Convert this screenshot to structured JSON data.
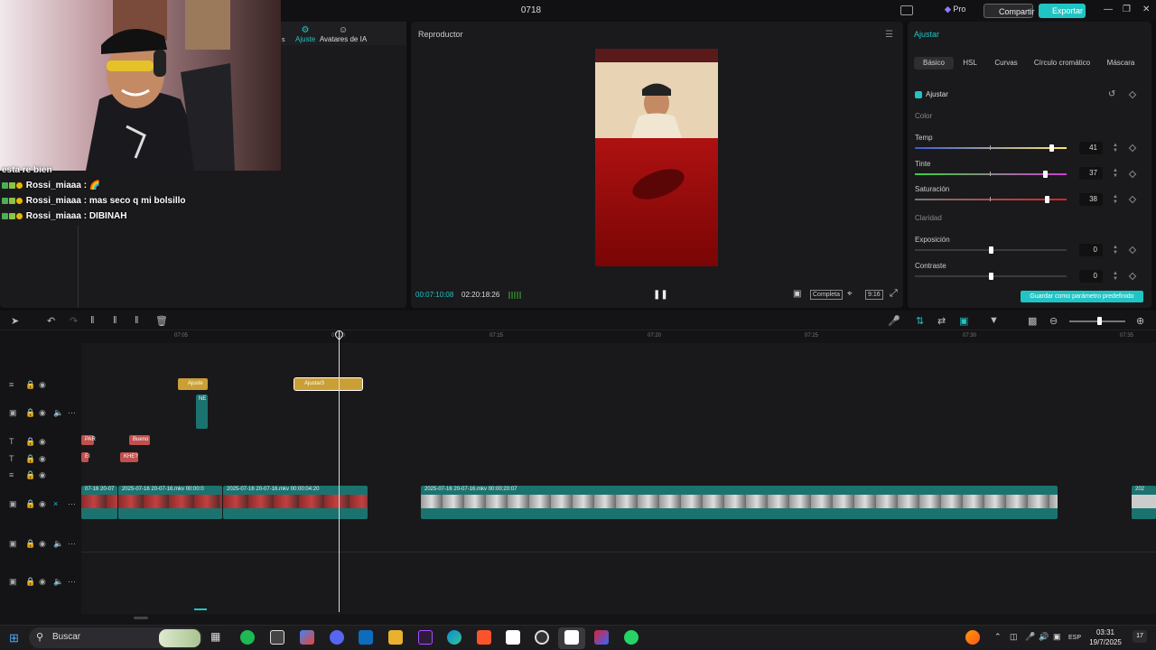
{
  "window": {
    "title": "0718"
  },
  "topbar": {
    "pro_label": "Pro",
    "share_label": "Compartir",
    "export_label": "Exportar"
  },
  "left_panel": {
    "tabs": [
      {
        "label": "s"
      },
      {
        "label": "Ajuste"
      },
      {
        "label": "Avatares de IA"
      }
    ],
    "chat": [
      {
        "text": "esta re bien"
      },
      {
        "user": "Rossi_miaaa",
        "text": "Rossi_miaaa : 🌈"
      },
      {
        "user": "Rossi_miaaa",
        "text": "Rossi_miaaa : mas seco q mi bolsillo"
      },
      {
        "user": "Rossi_miaaa",
        "text": "Rossi_miaaa : DIBINAH"
      }
    ]
  },
  "player": {
    "title": "Reproductor",
    "timecode_current": "00:07:10:08",
    "timecode_total": "02:20:18:26",
    "fit_label": "Completa",
    "ratio_label": "9:16"
  },
  "adjust_panel": {
    "title": "Ajustar",
    "tabs": [
      "Básico",
      "HSL",
      "Curvas",
      "Círculo cromático",
      "Máscara"
    ],
    "section_label": "Ajustar",
    "color_group": "Color",
    "claridad_group": "Claridad",
    "sliders": [
      {
        "label": "Temp",
        "value": "41",
        "fraction": 0.9
      },
      {
        "label": "Tinte",
        "value": "37",
        "fraction": 0.86
      },
      {
        "label": "Saturación",
        "value": "38",
        "fraction": 0.87
      },
      {
        "label": "Exposición",
        "value": "0",
        "fraction": 0.5
      },
      {
        "label": "Contraste",
        "value": "0",
        "fraction": 0.5
      }
    ],
    "save_label": "Guardar como parámetro predefinido"
  },
  "timeline": {
    "ruler": [
      "07:05",
      "07:10",
      "07:15",
      "07:20",
      "07:25",
      "07:30",
      "07:35"
    ],
    "adjust_clips": [
      "Ajuste",
      "Ajustar3"
    ],
    "text_clips": [
      "PAR",
      "Bueno",
      "EI",
      "KHE?"
    ],
    "video_clips": [
      {
        "label": "07-16 20-07"
      },
      {
        "label": "2025-07-16 20-07-16.mkv   00:00:0"
      },
      {
        "label": "2025-07-16 20-07-16.mkv   00:00:04:20"
      },
      {
        "label": "2025-07-16 20-07-16.mkv   00:00:20:07"
      },
      {
        "label": "202"
      }
    ],
    "overlay_label": "NE"
  },
  "taskbar": {
    "search_placeholder": "Buscar",
    "lang": "ESP",
    "time": "03:31",
    "date": "19/7/2025",
    "notif_count": "17"
  }
}
